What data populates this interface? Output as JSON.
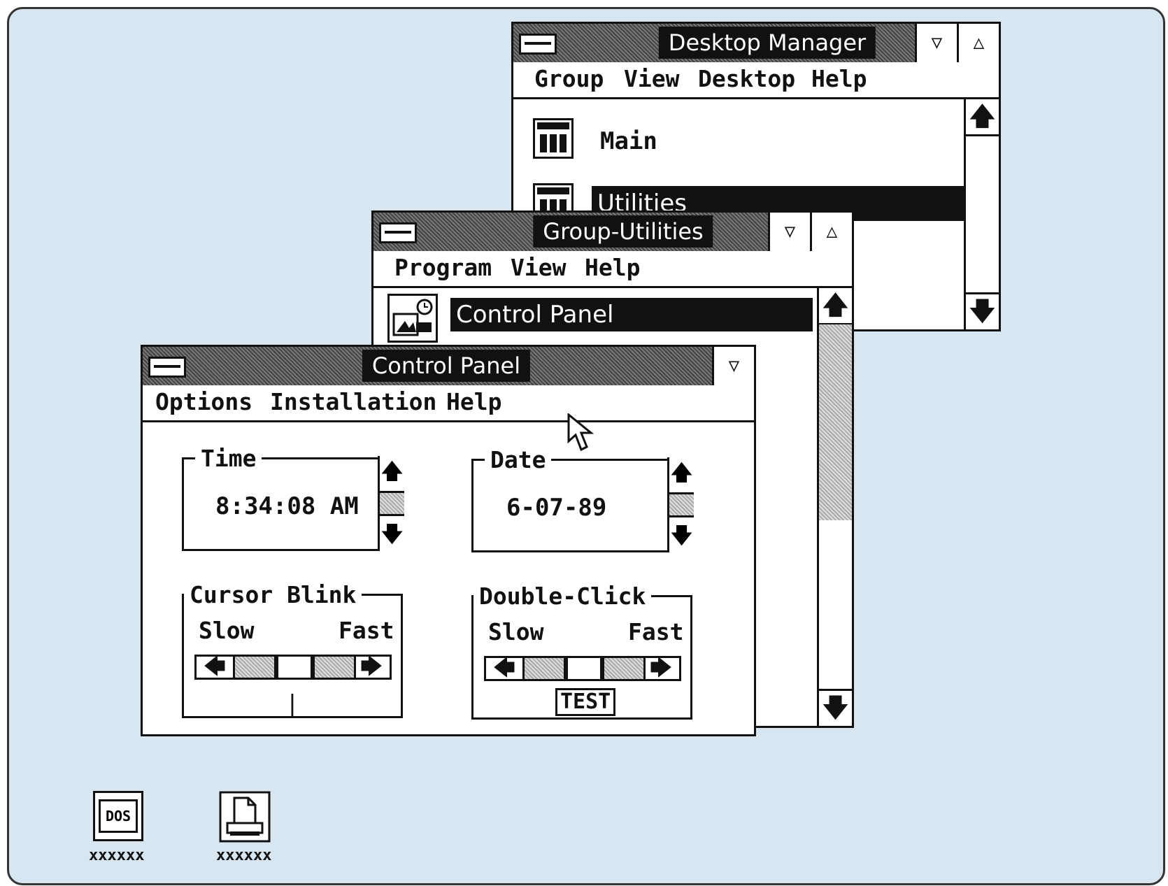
{
  "desktop_manager": {
    "title": "Desktop Manager",
    "menu": [
      "Group",
      "View",
      "Desktop",
      "Help"
    ],
    "items": [
      {
        "label": "Main"
      },
      {
        "label": "Utilities"
      }
    ],
    "minimize_glyph": "▽",
    "maximize_glyph": "△"
  },
  "group_utilities": {
    "title": "Group-Utilities",
    "menu": [
      "Program",
      "View",
      "Help"
    ],
    "items": [
      {
        "label": "Control Panel"
      }
    ],
    "minimize_glyph": "▽",
    "maximize_glyph": "△"
  },
  "control_panel": {
    "title": "Control Panel",
    "menu": [
      "Options",
      "Installation",
      "Help"
    ],
    "minimize_glyph": "▽",
    "time": {
      "label": "Time",
      "value": "8:34:08 AM"
    },
    "date": {
      "label": "Date",
      "value": "6-07-89"
    },
    "cursor_blink": {
      "label": "Cursor Blink",
      "slow": "Slow",
      "fast": "Fast",
      "cursor_glyph": "|"
    },
    "double_click": {
      "label": "Double-Click",
      "slow": "Slow",
      "fast": "Fast",
      "test": "TEST"
    }
  },
  "desktop_icons": [
    {
      "caption": "xxxxxx",
      "icon": "dos-icon",
      "text": "DOS"
    },
    {
      "caption": "xxxxxx",
      "icon": "printer-icon"
    }
  ],
  "glyphs": {
    "up": "🡅",
    "down": "🡇",
    "left": "🡄",
    "right": "🡆"
  },
  "colors": {
    "desktop": "#d7e6f0",
    "selection": "#111111"
  }
}
